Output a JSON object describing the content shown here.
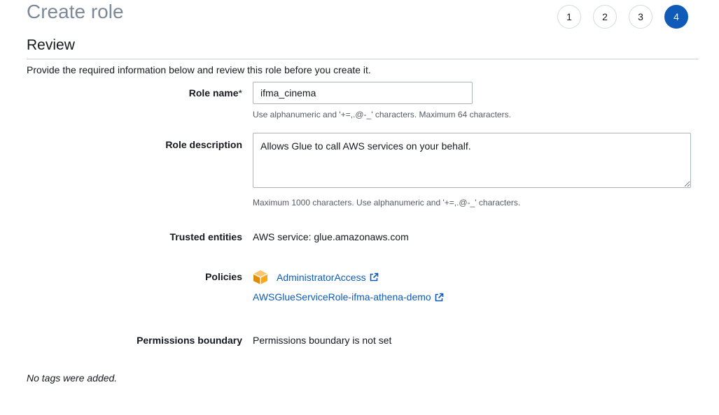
{
  "header": {
    "title": "Create role",
    "steps": [
      {
        "label": "1"
      },
      {
        "label": "2"
      },
      {
        "label": "3"
      },
      {
        "label": "4"
      }
    ]
  },
  "section": {
    "title": "Review",
    "intro": "Provide the required information below and review this role before you create it."
  },
  "form": {
    "role_name": {
      "label": "Role name",
      "required_mark": "*",
      "value": "ifma_cinema",
      "hint": "Use alphanumeric and '+=,.@-_' characters. Maximum 64 characters."
    },
    "role_description": {
      "label": "Role description",
      "value": "Allows Glue to call AWS services on your behalf.",
      "hint": "Maximum 1000 characters. Use alphanumeric and '+=,.@-_' characters."
    },
    "trusted_entities": {
      "label": "Trusted entities",
      "value": "AWS service: glue.amazonaws.com"
    },
    "policies": {
      "label": "Policies",
      "items": [
        {
          "name": "AdministratorAccess",
          "icon": "aws-managed-policy-icon"
        },
        {
          "name": "AWSGlueServiceRole-ifma-athena-demo",
          "icon": ""
        }
      ]
    },
    "permissions_boundary": {
      "label": "Permissions boundary",
      "value": "Permissions boundary is not set"
    }
  },
  "tags": {
    "empty_text": "No tags were added."
  },
  "colors": {
    "accent": "#0f5bb7",
    "title_gray": "#7d8998",
    "aws_orange": "#f7a81b"
  }
}
